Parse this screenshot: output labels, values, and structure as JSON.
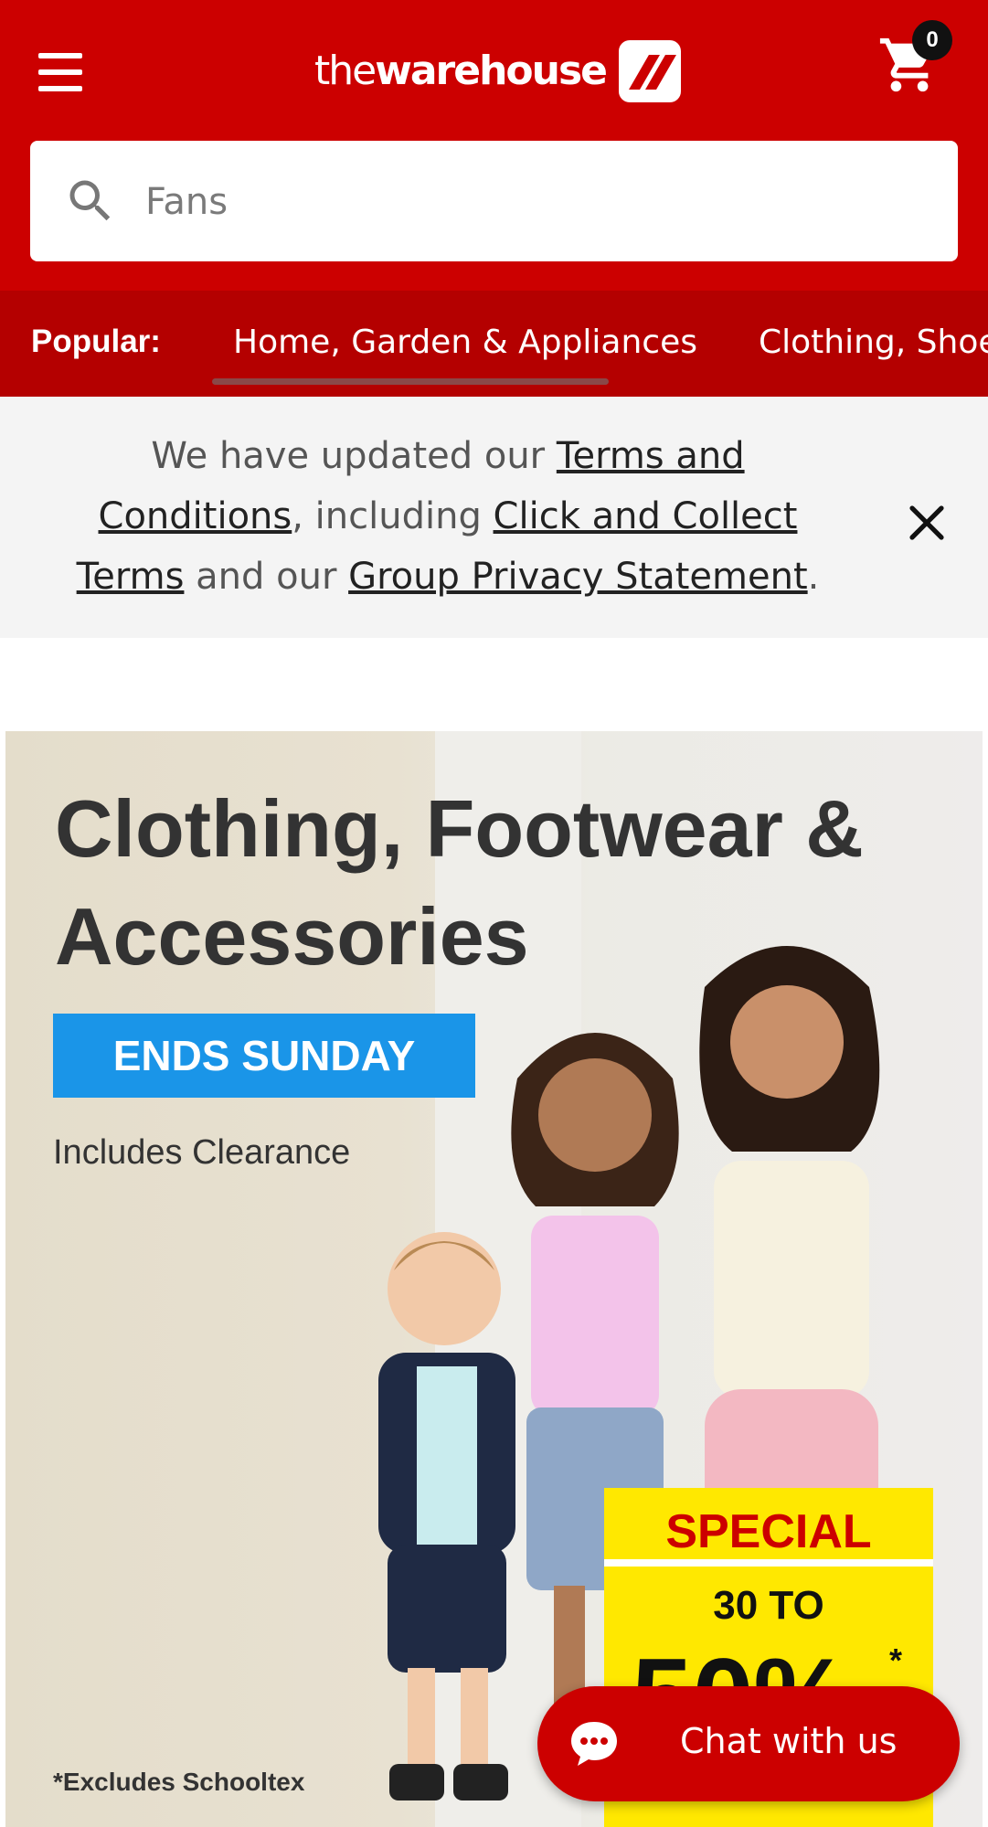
{
  "header": {
    "logo_prefix": "the",
    "logo_main": "warehouse",
    "cart_count": "0",
    "menu_icon": "hamburger-menu-icon",
    "cart_icon": "shopping-cart-icon",
    "brand_color": "#cc0000"
  },
  "search": {
    "placeholder": "Fans",
    "icon": "search-icon"
  },
  "popular": {
    "label": "Popular:",
    "items": [
      "Home, Garden & Appliances",
      "Clothing, Shoes"
    ]
  },
  "notice": {
    "part1": "We have updated our ",
    "link1": "Terms and Conditions",
    "part2": ", including ",
    "link2": "Click and Collect Terms",
    "part3": " and our ",
    "link3": "Group Privacy Statement",
    "part4": ".",
    "close_icon": "close-icon"
  },
  "banner": {
    "title": "Clothing, Footwear & Accessories",
    "ends": "ENDS SUNDAY",
    "includes": "Includes Clearance",
    "special_title": "SPECIAL",
    "special_range": "30 TO",
    "special_pct": "50%",
    "special_star": "*",
    "excludes": "*Excludes Schooltex"
  },
  "chat": {
    "label": "Chat with us",
    "icon": "chat-bubble-icon"
  }
}
